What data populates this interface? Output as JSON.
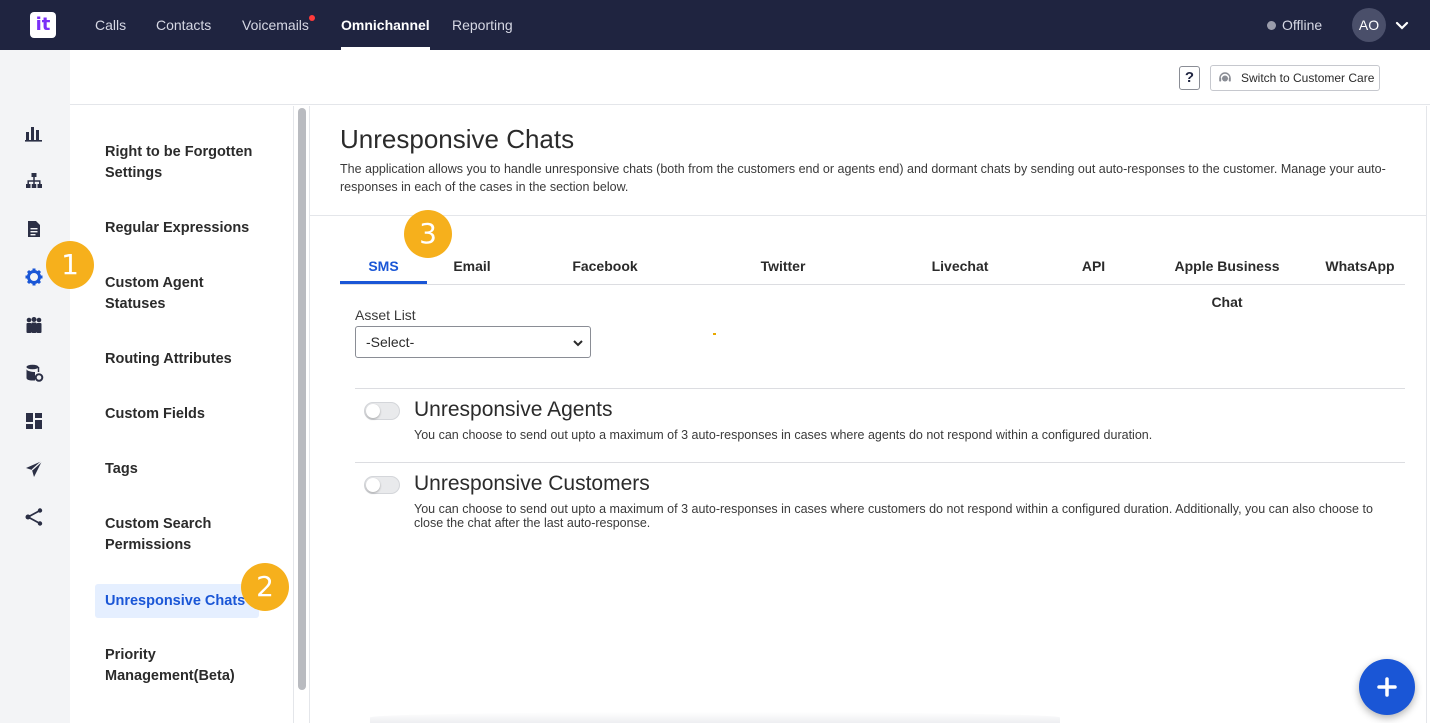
{
  "topnav": {
    "logo_text": "it",
    "items": [
      "Calls",
      "Contacts",
      "Voicemails",
      "Omnichannel",
      "Reporting"
    ],
    "active": "Omnichannel",
    "status": "Offline",
    "avatar_initials": "AO"
  },
  "rail": {
    "icons": [
      "bar-chart-icon",
      "org-chart-icon",
      "document-icon",
      "settings-gear-icon",
      "team-icon",
      "database-settings-icon",
      "dashboard-icon",
      "send-icon",
      "share-icon"
    ]
  },
  "header": {
    "help_label": "?",
    "switch_label": "Switch to Customer Care"
  },
  "settings_nav": {
    "items": [
      "Right to be Forgotten Settings",
      "Regular Expressions",
      "Custom Agent Statuses",
      "Routing Attributes",
      "Custom Fields",
      "Tags",
      "Custom Search Permissions",
      "Unresponsive Chats",
      "Priority Management(Beta)"
    ],
    "active": "Unresponsive Chats"
  },
  "main": {
    "title": "Unresponsive Chats",
    "description": "The application allows you to handle unresponsive chats (both from the customers end or agents end) and dormant chats by sending out auto-responses to the customer. Manage your auto-responses in each of the cases in the section below.",
    "tabs": [
      "SMS",
      "Email",
      "Facebook",
      "Twitter",
      "Livechat",
      "API",
      "Apple Business Chat",
      "WhatsApp"
    ],
    "active_tab": "SMS",
    "asset_list": {
      "label": "Asset List",
      "value": "-Select-"
    },
    "sections": [
      {
        "title": "Unresponsive Agents",
        "description": "You can choose to send out upto a maximum of 3 auto-responses in cases where agents do not respond within a configured duration.",
        "enabled": false
      },
      {
        "title": "Unresponsive Customers",
        "description": "You can choose to send out upto a maximum of 3 auto-responses in cases where customers do not respond within a configured duration. Additionally, you can also choose to close the chat after the last auto-response.",
        "enabled": false
      }
    ]
  },
  "badges": [
    "1",
    "2",
    "3"
  ],
  "colors": {
    "topbar": "#1f2440",
    "accent": "#1a56d6",
    "badge": "#f6b01c"
  }
}
